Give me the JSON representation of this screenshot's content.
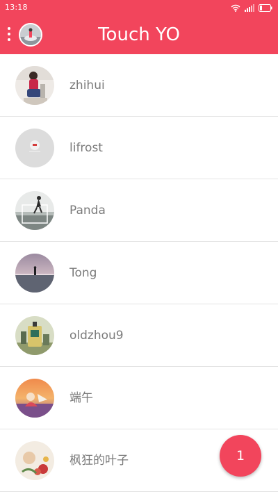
{
  "status_bar": {
    "time": "13:18",
    "icons": [
      "wifi-icon",
      "signal-icon",
      "battery-icon"
    ]
  },
  "app_bar": {
    "title": "Touch YO",
    "menu_icon": "more-vertical-icon"
  },
  "contacts": [
    {
      "name": "zhihui"
    },
    {
      "name": "lifrost"
    },
    {
      "name": "Panda"
    },
    {
      "name": "Tong"
    },
    {
      "name": "oldzhou9"
    },
    {
      "name": "端午"
    },
    {
      "name": "枫狂的叶子"
    }
  ],
  "fab": {
    "label": "1"
  },
  "colors": {
    "accent": "#f2455c",
    "text": "#7b7b7b",
    "divider": "#e4e4e4",
    "background": "#ffffff"
  }
}
